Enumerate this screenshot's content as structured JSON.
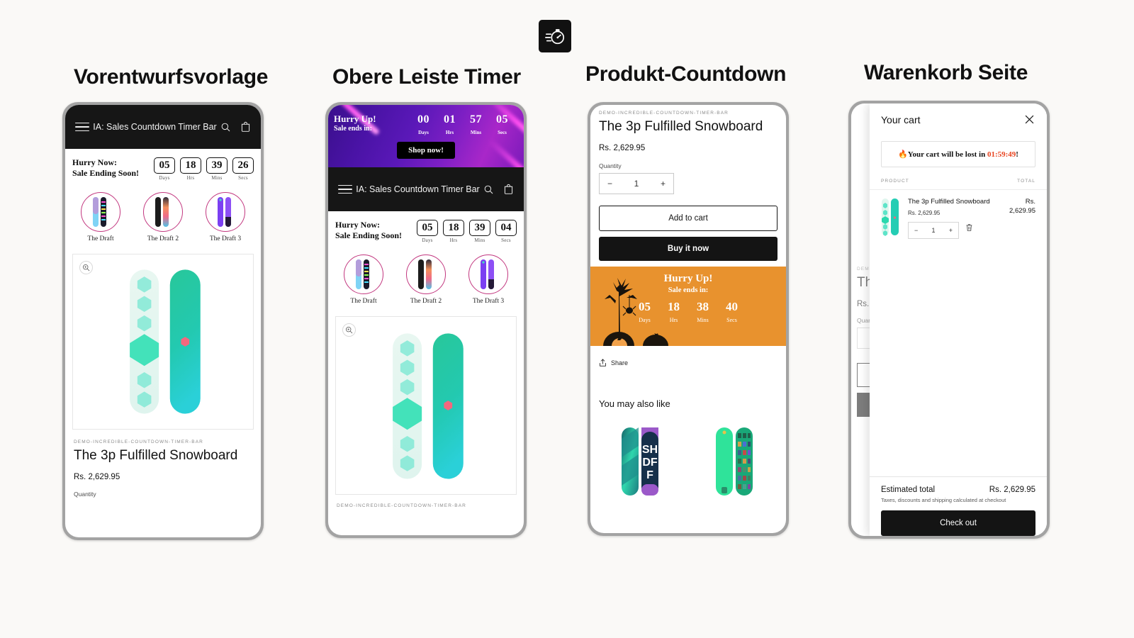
{
  "app": {
    "icon_name": "stopwatch-icon"
  },
  "columns": [
    {
      "title": "Vorentwurfsvorlage"
    },
    {
      "title": "Obere Leiste Timer"
    },
    {
      "title": "Produkt-Countdown"
    },
    {
      "title": "Warenkorb Seite"
    }
  ],
  "store": {
    "header_title": "IA: Sales Countdown Timer Bar",
    "menu_icon": "hamburger-icon",
    "search_icon": "search-icon",
    "cart_icon": "shopping-bag-icon"
  },
  "inline_timer": {
    "message_line1": "Hurry Now:",
    "message_line2": "Sale Ending Soon!",
    "units_p1": [
      {
        "value": "05",
        "label": "Days"
      },
      {
        "value": "18",
        "label": "Hrs"
      },
      {
        "value": "39",
        "label": "Mins"
      },
      {
        "value": "26",
        "label": "Secs"
      }
    ],
    "units_p2": [
      {
        "value": "05",
        "label": "Days"
      },
      {
        "value": "18",
        "label": "Hrs"
      },
      {
        "value": "39",
        "label": "Mins"
      },
      {
        "value": "04",
        "label": "Secs"
      }
    ]
  },
  "collections": [
    {
      "label": "The Draft"
    },
    {
      "label": "The Draft 2"
    },
    {
      "label": "The Draft 3"
    }
  ],
  "product": {
    "vendor": "DEMO-INCREDIBLE-COUNTDOWN-TIMER-BAR",
    "title": "The 3p Fulfilled Snowboard",
    "price": "Rs. 2,629.95",
    "quantity_label": "Quantity",
    "quantity_value": "1",
    "minus": "−",
    "plus": "+",
    "add_to_cart": "Add to cart",
    "buy_it_now": "Buy it now",
    "share_label": "Share",
    "share_icon": "share-icon",
    "zoom_icon": "zoom-in-icon",
    "recommendations_title": "You may also like"
  },
  "top_bar_timer": {
    "message_line1": "Hurry Up!",
    "message_line2": "Sale ends in:",
    "units": [
      {
        "value": "00",
        "label": "Days"
      },
      {
        "value": "01",
        "label": "Hrs"
      },
      {
        "value": "57",
        "label": "Mins"
      },
      {
        "value": "05",
        "label": "Secs"
      }
    ],
    "cta": "Shop now!"
  },
  "product_timer": {
    "message_line1": "Hurry Up!",
    "message_line2": "Sale ends in:",
    "units": [
      {
        "value": "05",
        "label": "Days"
      },
      {
        "value": "18",
        "label": "Hrs"
      },
      {
        "value": "38",
        "label": "Mins"
      },
      {
        "value": "40",
        "label": "Secs"
      }
    ],
    "theme_color": "#e8922e"
  },
  "cart": {
    "title": "Your cart",
    "close_icon": "close-icon",
    "alert_prefix": "🔥Your cart will be lost in ",
    "alert_time": "01:59:49",
    "alert_suffix": "!",
    "col_product": "PRODUCT",
    "col_total": "TOTAL",
    "item": {
      "name": "The 3p Fulfilled Snowboard",
      "price": "Rs. 2,629.95",
      "line_total": "Rs. 2,629.95",
      "quantity": "1",
      "minus": "−",
      "plus": "+",
      "remove_icon": "trash-icon"
    },
    "estimated_total_label": "Estimated total",
    "estimated_total_value": "Rs. 2,629.95",
    "tax_note": "Taxes, discounts and shipping calculated at checkout",
    "checkout_label": "Check out"
  },
  "colors": {
    "background": "#faf9f7",
    "frame": "#a3a3a3",
    "header": "#161616",
    "accent_pink": "#c2377f",
    "orange": "#e8922e",
    "alert_red": "#e8431f"
  }
}
